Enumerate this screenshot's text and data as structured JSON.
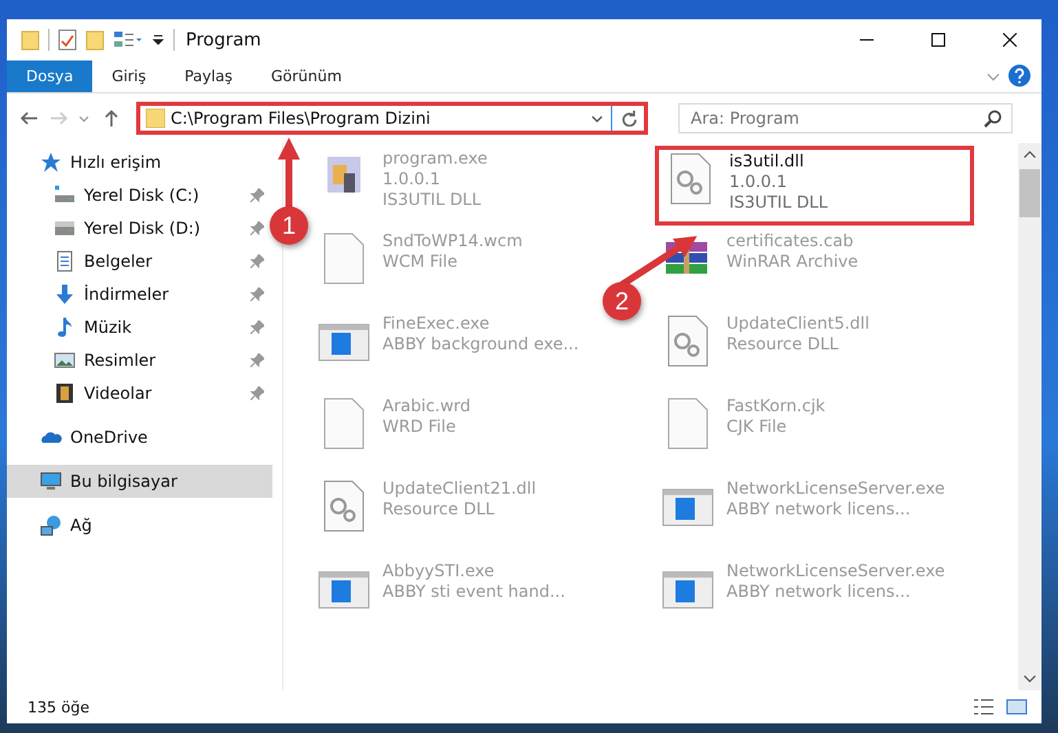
{
  "window": {
    "title": "Program"
  },
  "ribbon_tabs": [
    {
      "label": "Dosya",
      "selected": true
    },
    {
      "label": "Giriş",
      "selected": false
    },
    {
      "label": "Paylaş",
      "selected": false
    },
    {
      "label": "Görünüm",
      "selected": false
    }
  ],
  "address_bar": {
    "value": "C:\\Program Files\\Program Dizini",
    "highlighted": true
  },
  "search": {
    "placeholder": "Ara: Program"
  },
  "sidebar": {
    "items": [
      {
        "label": "Hızlı erişim",
        "kind": "star",
        "pinned": false,
        "selected": false,
        "children": [
          {
            "label": "Yerel Disk (C:)",
            "kind": "drive-c",
            "pinned": true,
            "selected": false
          },
          {
            "label": "Yerel Disk (D:)",
            "kind": "drive",
            "pinned": true,
            "selected": false
          },
          {
            "label": "Belgeler",
            "kind": "document",
            "pinned": true,
            "selected": false
          },
          {
            "label": "İndirmeler",
            "kind": "download",
            "pinned": true,
            "selected": false
          },
          {
            "label": "Müzik",
            "kind": "music",
            "pinned": true,
            "selected": false
          },
          {
            "label": "Resimler",
            "kind": "picture",
            "pinned": true,
            "selected": false
          },
          {
            "label": "Videolar",
            "kind": "video",
            "pinned": true,
            "selected": false
          }
        ]
      },
      {
        "label": "OneDrive",
        "kind": "cloud",
        "pinned": false,
        "selected": false
      },
      {
        "label": "Bu bilgisayar",
        "kind": "computer",
        "pinned": false,
        "selected": true
      },
      {
        "label": "Ağ",
        "kind": "network",
        "pinned": false,
        "selected": false
      }
    ]
  },
  "files": [
    {
      "name": "program.exe",
      "details": [
        "1.0.0.1",
        "IS3UTIL DLL"
      ],
      "kind": "program",
      "highlighted": false
    },
    {
      "name": "is3util.dll",
      "details": [
        "1.0.0.1",
        "IS3UTIL DLL"
      ],
      "kind": "dll",
      "highlighted": true
    },
    {
      "name": "SndToWP14.wcm",
      "details": [
        "WCM File"
      ],
      "kind": "file",
      "highlighted": false
    },
    {
      "name": "certificates.cab",
      "details": [
        "WinRAR Archive"
      ],
      "kind": "archive",
      "highlighted": false
    },
    {
      "name": "FineExec.exe",
      "details": [
        "ABBY background exe..."
      ],
      "kind": "app",
      "highlighted": false
    },
    {
      "name": "UpdateClient5.dll",
      "details": [
        "Resource DLL"
      ],
      "kind": "dll",
      "highlighted": false
    },
    {
      "name": "Arabic.wrd",
      "details": [
        "WRD File"
      ],
      "kind": "file",
      "highlighted": false
    },
    {
      "name": "FastKorn.cjk",
      "details": [
        "CJK File"
      ],
      "kind": "file",
      "highlighted": false
    },
    {
      "name": "UpdateClient21.dll",
      "details": [
        "Resource DLL"
      ],
      "kind": "dll",
      "highlighted": false
    },
    {
      "name": "NetworkLicenseServer.exe",
      "details": [
        "ABBY network licens..."
      ],
      "kind": "app",
      "highlighted": false
    },
    {
      "name": "AbbyySTI.exe",
      "details": [
        "ABBY sti event hand..."
      ],
      "kind": "app",
      "highlighted": false
    },
    {
      "name": "NetworkLicenseServer.exe",
      "details": [
        "ABBY network licens..."
      ],
      "kind": "app",
      "highlighted": false
    }
  ],
  "callouts": [
    {
      "number": "1"
    },
    {
      "number": "2"
    }
  ],
  "status_bar": {
    "item_count": "135 öğe"
  }
}
